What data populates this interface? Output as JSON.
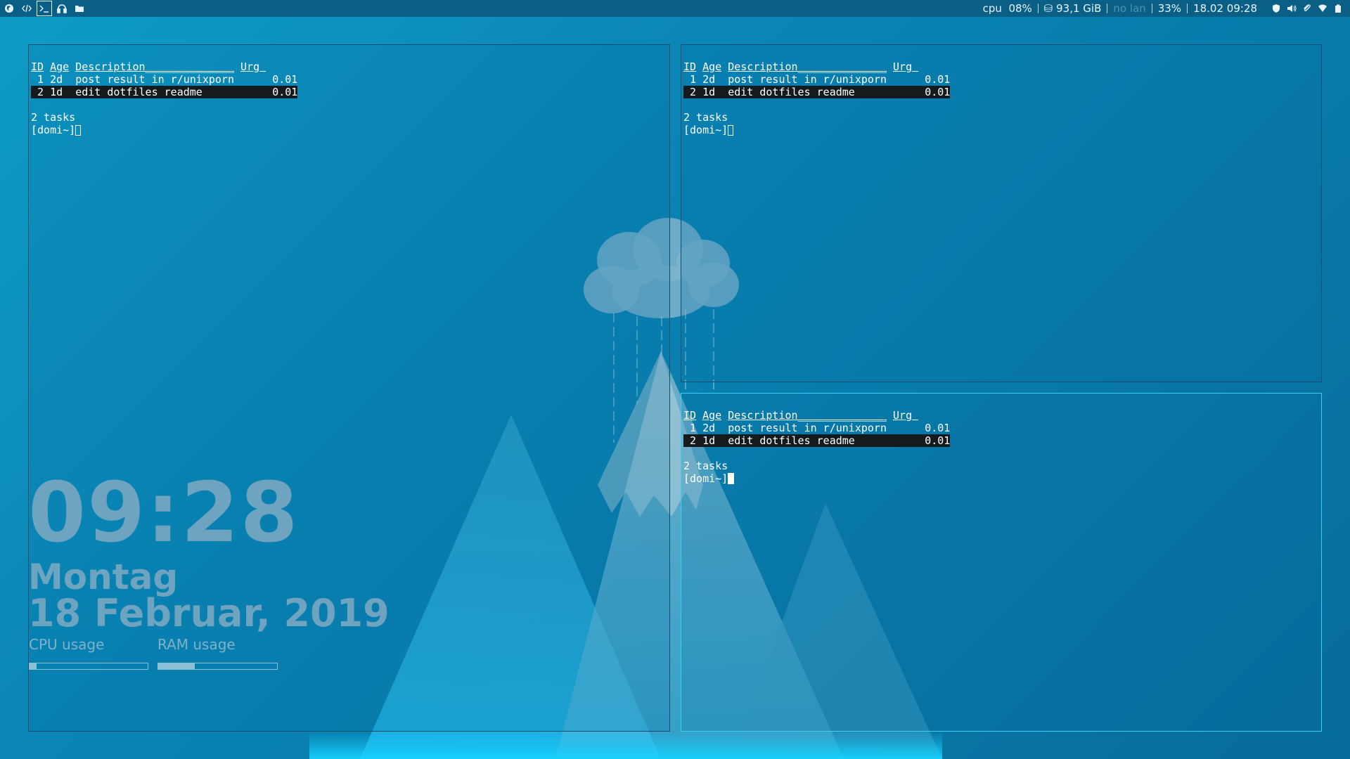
{
  "topbar": {
    "launchers": [
      {
        "name": "firefox-icon",
        "active": false
      },
      {
        "name": "code-editor-icon",
        "active": false
      },
      {
        "name": "terminal-icon",
        "active": true
      },
      {
        "name": "headphones-icon",
        "active": false
      },
      {
        "name": "folder-icon",
        "active": false
      }
    ],
    "cpu_label": "cpu",
    "cpu_value": "08%",
    "disk": "⛁ 93,1 GiB",
    "network": "no lan",
    "battery": "33%",
    "datetime": "18.02 09:28",
    "tray_icons": [
      "shield-icon",
      "volume-icon",
      "paperclip-icon",
      "wifi-icon",
      "battery-icon"
    ]
  },
  "terminals": [
    {
      "headers": {
        "id": "ID",
        "age": "Age",
        "description": "Description",
        "urg": "Urg"
      },
      "tasks": [
        {
          "id": "1",
          "age": "2d",
          "description": "post result in r/unixporn",
          "urg": "0.01"
        },
        {
          "id": "2",
          "age": "1d",
          "description": "edit dotfiles readme",
          "urg": "0.01"
        }
      ],
      "summary": "2 tasks",
      "prompt": "[domi~]"
    },
    {
      "headers": {
        "id": "ID",
        "age": "Age",
        "description": "Description",
        "urg": "Urg"
      },
      "tasks": [
        {
          "id": "1",
          "age": "2d",
          "description": "post result in r/unixporn",
          "urg": "0.01"
        },
        {
          "id": "2",
          "age": "1d",
          "description": "edit dotfiles readme",
          "urg": "0.01"
        }
      ],
      "summary": "2 tasks",
      "prompt": "[domi~]"
    },
    {
      "headers": {
        "id": "ID",
        "age": "Age",
        "description": "Description",
        "urg": "Urg"
      },
      "tasks": [
        {
          "id": "1",
          "age": "2d",
          "description": "post result in r/unixporn",
          "urg": "0.01"
        },
        {
          "id": "2",
          "age": "1d",
          "description": "edit dotfiles readme",
          "urg": "0.01"
        }
      ],
      "summary": "2 tasks",
      "prompt": "[domi~]"
    }
  ],
  "conky": {
    "time": "09:28",
    "day": "Montag",
    "date": "18 Februar, 2019",
    "cpu_label": "CPU usage",
    "ram_label": "RAM usage",
    "cpu_level": 0.06,
    "ram_level": 0.31
  },
  "colors": {
    "bar_bg": "#0a5f86",
    "focused_border": "#35d0f5",
    "selected_row": "#141a1e"
  }
}
